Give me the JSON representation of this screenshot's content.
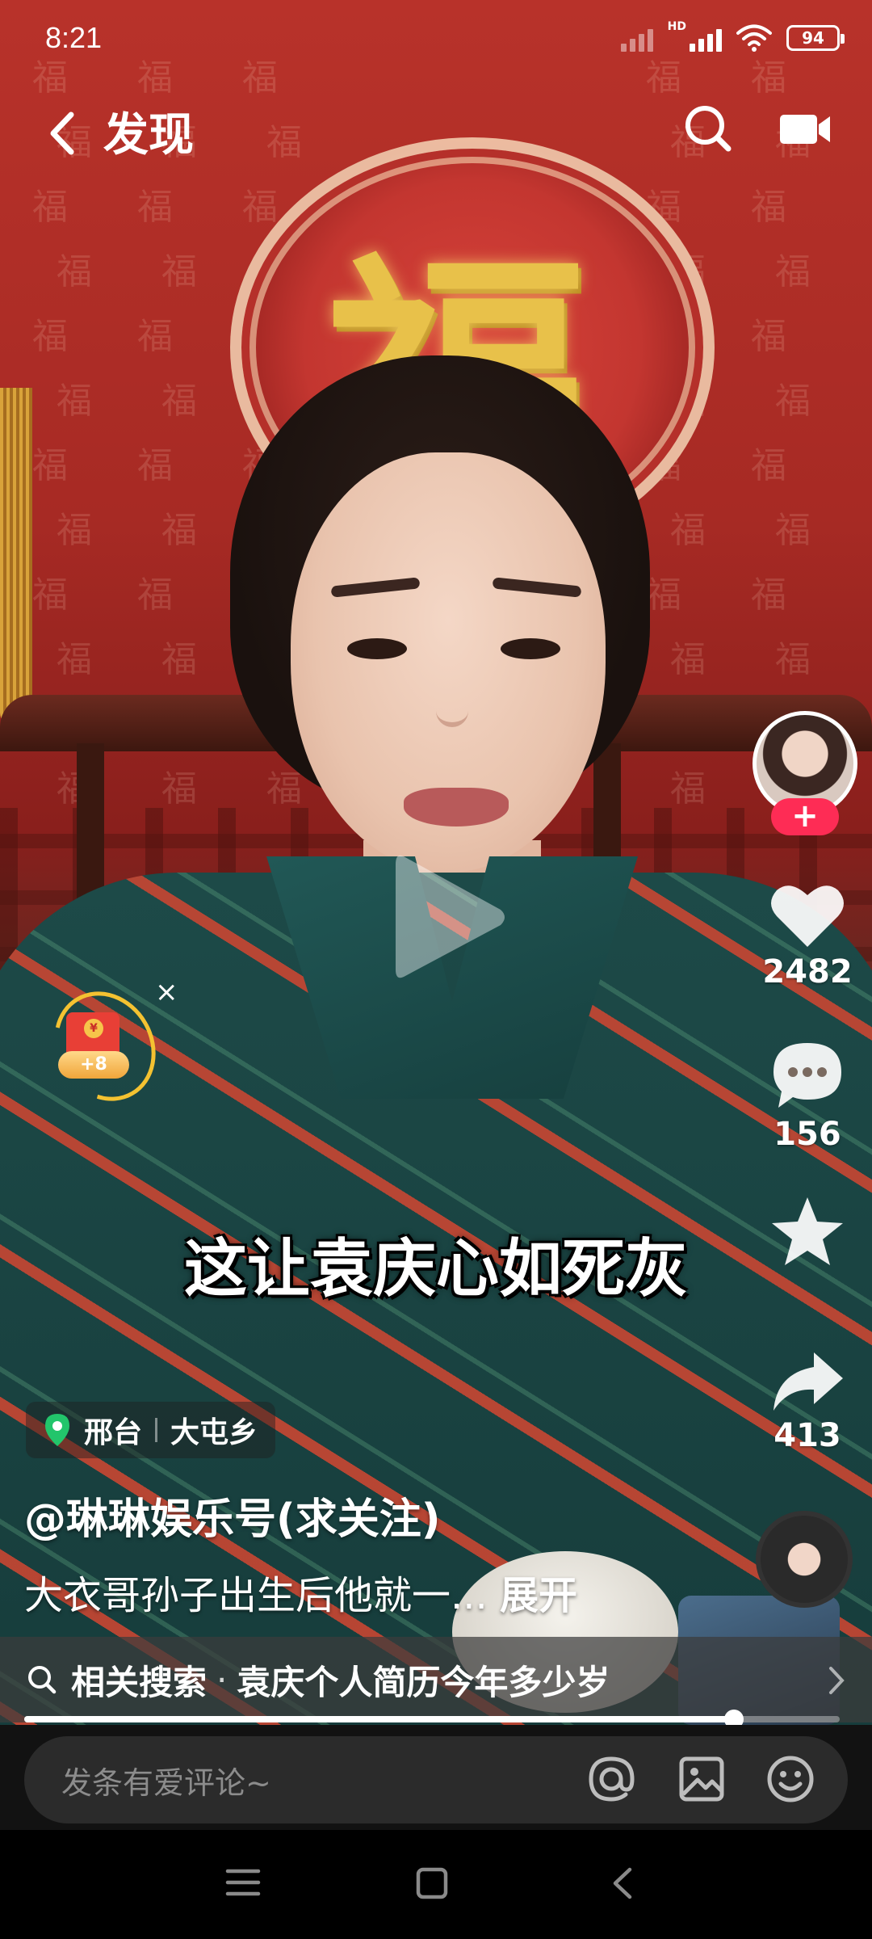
{
  "status_bar": {
    "time": "8:21",
    "network": "HD",
    "battery": "94",
    "icons": [
      "signal-dim-icon",
      "signal-icon",
      "wifi-icon",
      "battery-icon"
    ]
  },
  "top_nav": {
    "back_icon": "chevron-left-icon",
    "title": "发现",
    "search_icon": "search-icon",
    "camera_icon": "video-camera-icon"
  },
  "video": {
    "subtitle": "这让袁庆心如死灰",
    "play_icon": "play-icon",
    "background_glyph": "福"
  },
  "red_envelope": {
    "coin": "¥",
    "bonus": "+8",
    "close": "×",
    "accent": "#f4c231"
  },
  "actions": {
    "follow_label": "+",
    "like_count": "2482",
    "comment_count": "156",
    "share_count": "413",
    "like_icon": "heart-icon",
    "comment_icon": "comment-bubble-icon",
    "favorite_icon": "star-icon",
    "share_icon": "share-arrow-icon",
    "follow_color": "#fe2c55"
  },
  "post": {
    "location": [
      "邢台",
      "大屯乡"
    ],
    "location_icon": "location-pin-icon",
    "location_color": "#22c56b",
    "author": "@琳琳娱乐号(求关注)",
    "caption": "大衣哥孙子出生后他就一...",
    "expand": "展开"
  },
  "related_search": {
    "label": "相关搜索",
    "separator": "·",
    "query": "袁庆个人简历今年多少岁"
  },
  "playback": {
    "progress": 0.87
  },
  "comment_bar": {
    "placeholder": "发条有爱评论~",
    "icons": [
      "at-icon",
      "image-icon",
      "emoji-icon"
    ]
  },
  "system_nav": {
    "icons": [
      "menu-icon",
      "home-square-icon",
      "back-chevron-icon"
    ]
  }
}
